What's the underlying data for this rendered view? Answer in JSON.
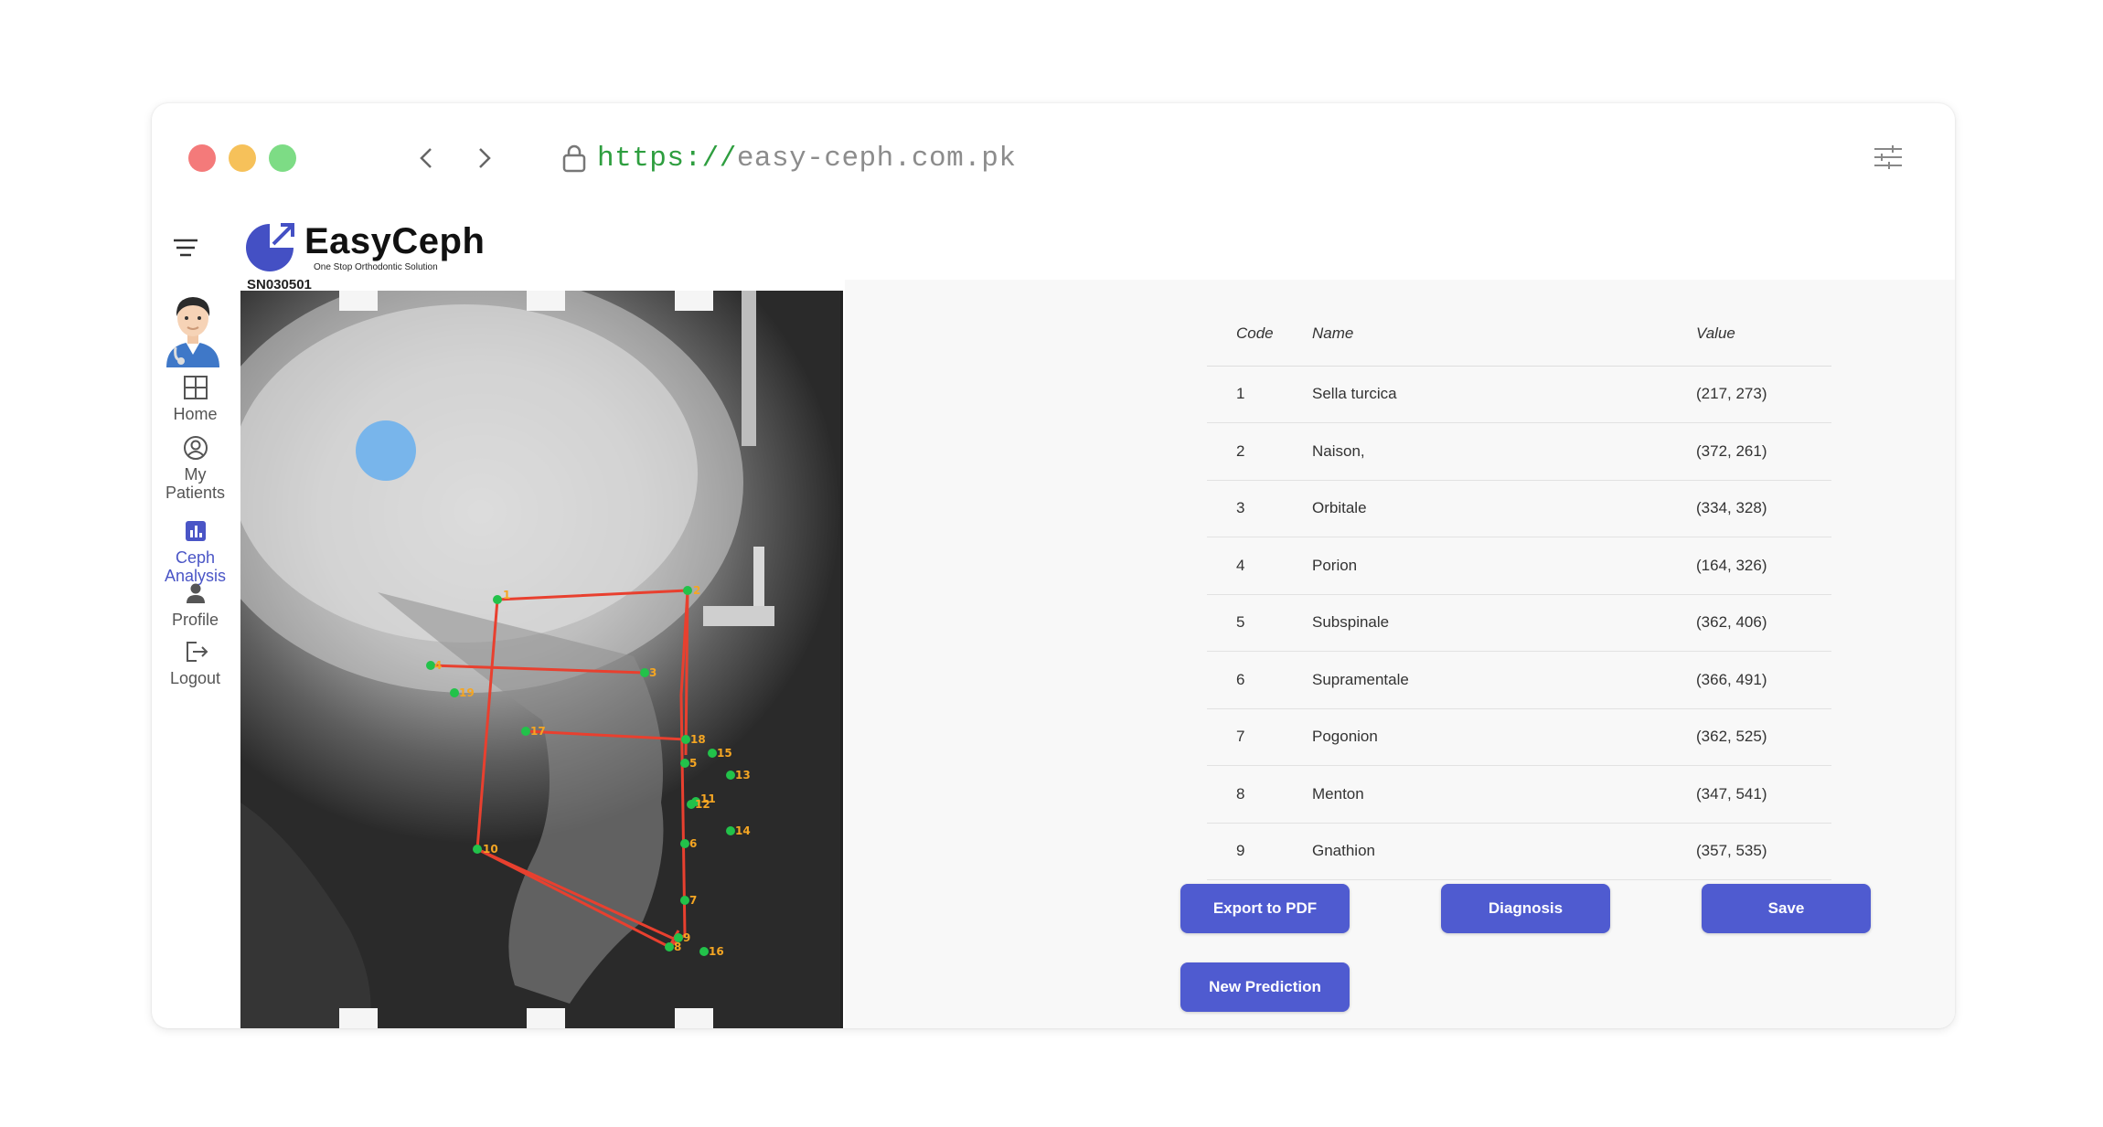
{
  "browser": {
    "url_protocol": "https://",
    "url_host": "easy-ceph.com.pk",
    "traffic_colors": [
      "#f47a7a",
      "#f6c15a",
      "#7ddc85"
    ]
  },
  "app": {
    "logo_name": "EasyCeph",
    "logo_tagline": "One Stop Orthodontic Solution",
    "accent_color": "#4f5bd0",
    "image_id": "SN030501"
  },
  "sidebar": {
    "items": [
      {
        "label_line1": "Home",
        "label_line2": "",
        "icon": "grid-icon"
      },
      {
        "label_line1": "My",
        "label_line2": "Patients",
        "icon": "user-circle-icon"
      },
      {
        "label_line1": "Ceph",
        "label_line2": "Analysis",
        "icon": "bar-chart-icon",
        "active": true
      },
      {
        "label_line1": "Profile",
        "label_line2": "",
        "icon": "person-icon"
      },
      {
        "label_line1": "Logout",
        "label_line2": "",
        "icon": "logout-icon"
      }
    ]
  },
  "table": {
    "headers": {
      "code": "Code",
      "name": "Name",
      "value": "Value"
    },
    "rows": [
      {
        "code": "1",
        "name": "Sella turcica",
        "value": "(217, 273)"
      },
      {
        "code": "2",
        "name": "Naison,",
        "value": "(372, 261)"
      },
      {
        "code": "3",
        "name": "Orbitale",
        "value": "(334, 328)"
      },
      {
        "code": "4",
        "name": "Porion",
        "value": "(164, 326)"
      },
      {
        "code": "5",
        "name": "Subspinale",
        "value": "(362, 406)"
      },
      {
        "code": "6",
        "name": "Supramentale",
        "value": "(366, 491)"
      },
      {
        "code": "7",
        "name": "Pogonion",
        "value": "(362, 525)"
      },
      {
        "code": "8",
        "name": "Menton",
        "value": "(347, 541)"
      },
      {
        "code": "9",
        "name": "Gnathion",
        "value": "(357, 535)"
      }
    ]
  },
  "buttons": {
    "export": "Export to PDF",
    "diagnosis": "Diagnosis",
    "save": "Save",
    "new_prediction": "New Prediction"
  },
  "landmark_labels": [
    "1",
    "2",
    "3",
    "4",
    "5",
    "6",
    "7",
    "8",
    "9",
    "10",
    "11",
    "12",
    "13",
    "14",
    "15",
    "16",
    "17",
    "18",
    "19"
  ]
}
